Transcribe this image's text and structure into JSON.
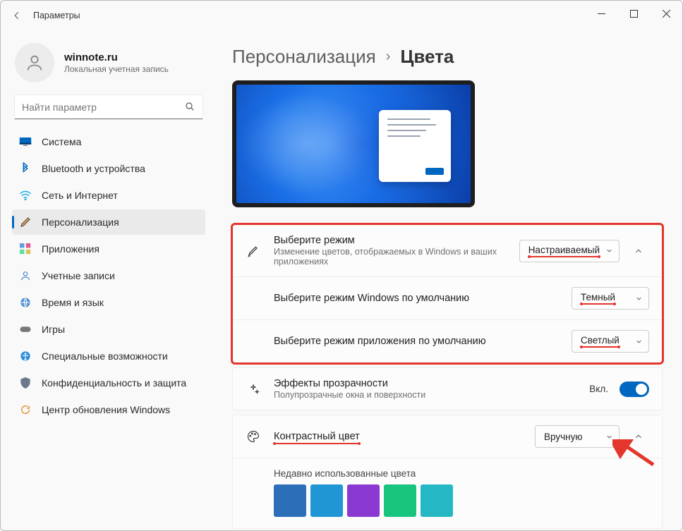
{
  "window": {
    "title": "Параметры"
  },
  "profile": {
    "name": "winnote.ru",
    "sub": "Локальная учетная запись"
  },
  "search": {
    "placeholder": "Найти параметр"
  },
  "nav": [
    {
      "label": "Система",
      "icon": "💻"
    },
    {
      "label": "Bluetooth и устройства",
      "icon": "bt"
    },
    {
      "label": "Сеть и Интернет",
      "icon": "wifi"
    },
    {
      "label": "Персонализация",
      "icon": "🖌"
    },
    {
      "label": "Приложения",
      "icon": "apps"
    },
    {
      "label": "Учетные записи",
      "icon": "👤"
    },
    {
      "label": "Время и язык",
      "icon": "🌐"
    },
    {
      "label": "Игры",
      "icon": "🎮"
    },
    {
      "label": "Специальные возможности",
      "icon": "acc"
    },
    {
      "label": "Конфиденциальность и защита",
      "icon": "🛡"
    },
    {
      "label": "Центр обновления Windows",
      "icon": "upd"
    }
  ],
  "breadcrumb": {
    "parent": "Персонализация",
    "current": "Цвета"
  },
  "mode": {
    "title": "Выберите режим",
    "desc": "Изменение цветов, отображаемых в Windows и ваших приложениях",
    "value": "Настраиваемый",
    "winLabel": "Выберите режим Windows по умолчанию",
    "winValue": "Темный",
    "appLabel": "Выберите режим приложения по умолчанию",
    "appValue": "Светлый"
  },
  "transparency": {
    "title": "Эффекты прозрачности",
    "desc": "Полупрозрачные окна и поверхности",
    "state": "Вкл."
  },
  "accent": {
    "title": "Контрастный цвет",
    "value": "Вручную",
    "recentLabel": "Недавно использованные цвета",
    "recentColors": [
      "#2c6fb8",
      "#2096d4",
      "#8b3ad1",
      "#19c47d",
      "#25b8c4"
    ]
  }
}
